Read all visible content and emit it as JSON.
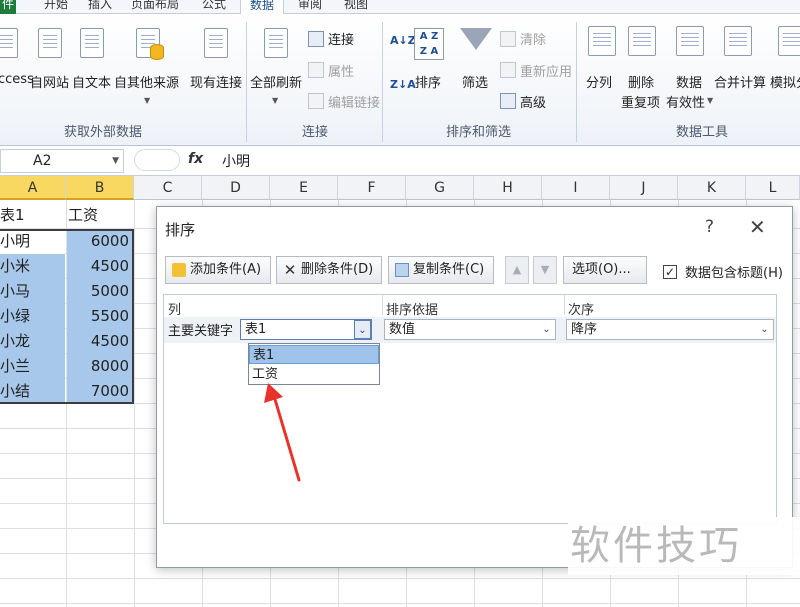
{
  "ribbon": {
    "tabs": [
      "件",
      "开始",
      "插入",
      "页面布局",
      "公式",
      "数据",
      "审阅",
      "视图"
    ],
    "active_tab": "数据",
    "external_data": {
      "buttons": [
        "ccess",
        "自网站",
        "自文本",
        "自其他来源",
        "现有连接"
      ],
      "group_label": "获取外部数据"
    },
    "connections": {
      "refresh_all": "全部刷新",
      "connections": "连接",
      "properties": "属性",
      "edit_links": "编辑链接",
      "group_label": "连接"
    },
    "sort_filter": {
      "sort": "排序",
      "filter": "筛选",
      "clear": "清除",
      "reapply": "重新应用",
      "advanced": "高级",
      "group_label": "排序和筛选"
    },
    "data_tools": {
      "split": "分列",
      "remove_dup_1": "删除",
      "remove_dup_2": "重复项",
      "validation_1": "数据",
      "validation_2": "有效性",
      "consolidate": "合并计算",
      "whatif": "模拟分",
      "group_label": "数据工具"
    }
  },
  "formula_bar": {
    "name_box": "A2",
    "fx": "fx",
    "value": "小明"
  },
  "sheet": {
    "columns": [
      "A",
      "B",
      "C",
      "D",
      "E",
      "F",
      "G",
      "H",
      "I",
      "J",
      "K",
      "L"
    ],
    "header_row": [
      "表1",
      "工资"
    ],
    "rows": [
      {
        "name": "小明",
        "salary": "6000"
      },
      {
        "name": "小米",
        "salary": "4500"
      },
      {
        "name": "小马",
        "salary": "5000"
      },
      {
        "name": "小绿",
        "salary": "5500"
      },
      {
        "name": "小龙",
        "salary": "4500"
      },
      {
        "name": "小兰",
        "salary": "8000"
      },
      {
        "name": "小结",
        "salary": "7000"
      }
    ]
  },
  "dialog": {
    "title": "排序",
    "help": "?",
    "close": "✕",
    "add_level": "添加条件(A)",
    "delete_level": "删除条件(D)",
    "copy_level": "复制条件(C)",
    "move_up": "▲",
    "move_down": "▼",
    "options": "选项(O)...",
    "has_headers_label": "数据包含标题(H)",
    "has_headers_checked": "✓",
    "col_header": "列",
    "sort_on_header": "排序依据",
    "order_header": "次序",
    "sort_by_label": "主要关键字",
    "column_value": "表1",
    "sort_on_value": "数值",
    "order_value": "降序",
    "dropdown_options": [
      "表1",
      "工资"
    ]
  },
  "watermark": "软件技巧",
  "colors": {
    "selection": "#a7c8ea",
    "header_selected": "#f8d860",
    "annotation_arrow": "#e8332a",
    "file_tab": "#1f7b3d"
  }
}
